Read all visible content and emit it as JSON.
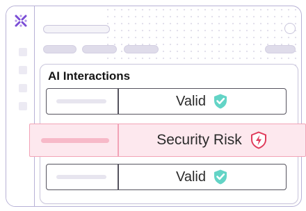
{
  "panel": {
    "title": "AI Interactions",
    "rows": [
      {
        "label": "Valid",
        "status": "valid",
        "icon": "check-shield-icon"
      },
      {
        "label": "Security Risk",
        "status": "risk",
        "icon": "lightning-shield-icon"
      },
      {
        "label": "Valid",
        "status": "valid",
        "icon": "check-shield-icon"
      }
    ]
  },
  "colors": {
    "brand": "#7a4dd6",
    "valid": "#63d4c6",
    "risk": "#f2a3b7",
    "risk_icon": "#e03b5b"
  },
  "icons": [
    "logo-icon",
    "check-shield-icon",
    "lightning-shield-icon"
  ]
}
